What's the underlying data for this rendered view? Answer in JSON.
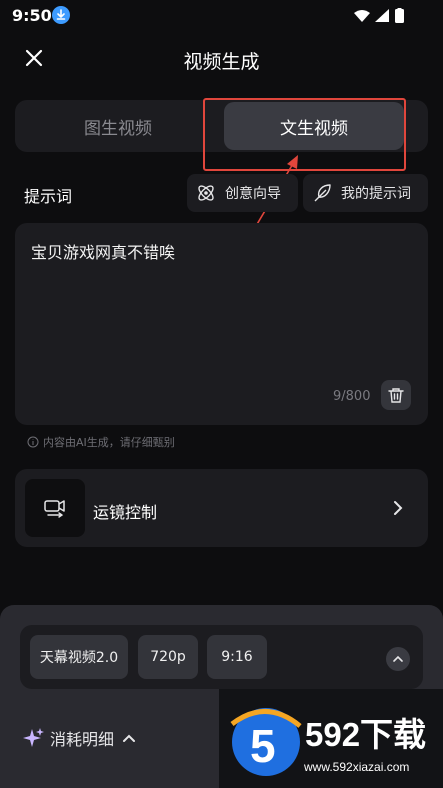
{
  "status": {
    "time": "9:50"
  },
  "header": {
    "title": "视频生成"
  },
  "tabs": [
    {
      "label": "图生视频"
    },
    {
      "label": "文生视频"
    }
  ],
  "prompt": {
    "label": "提示词",
    "creative_label": "创意向导",
    "my_prompts_label": "我的提示词",
    "value": "宝贝游戏网真不错唉",
    "counter": "9/800"
  },
  "note": "内容由AI生成，请仔细甄别",
  "camera": {
    "label": "运镜控制"
  },
  "options": {
    "model": "天幕视频2.0",
    "resolution": "720p",
    "ratio": "9:16"
  },
  "cost": {
    "label": "消耗明细"
  },
  "watermark": {
    "text": "592下载",
    "url": "www.592xiazai.com",
    "logo_digit": "5"
  },
  "colors": {
    "background": "#0d0d0f",
    "card": "#1c1c20",
    "active_tab": "#3a3b42",
    "annotation_red": "#e0463c",
    "accent_blue": "#3d9bff"
  }
}
